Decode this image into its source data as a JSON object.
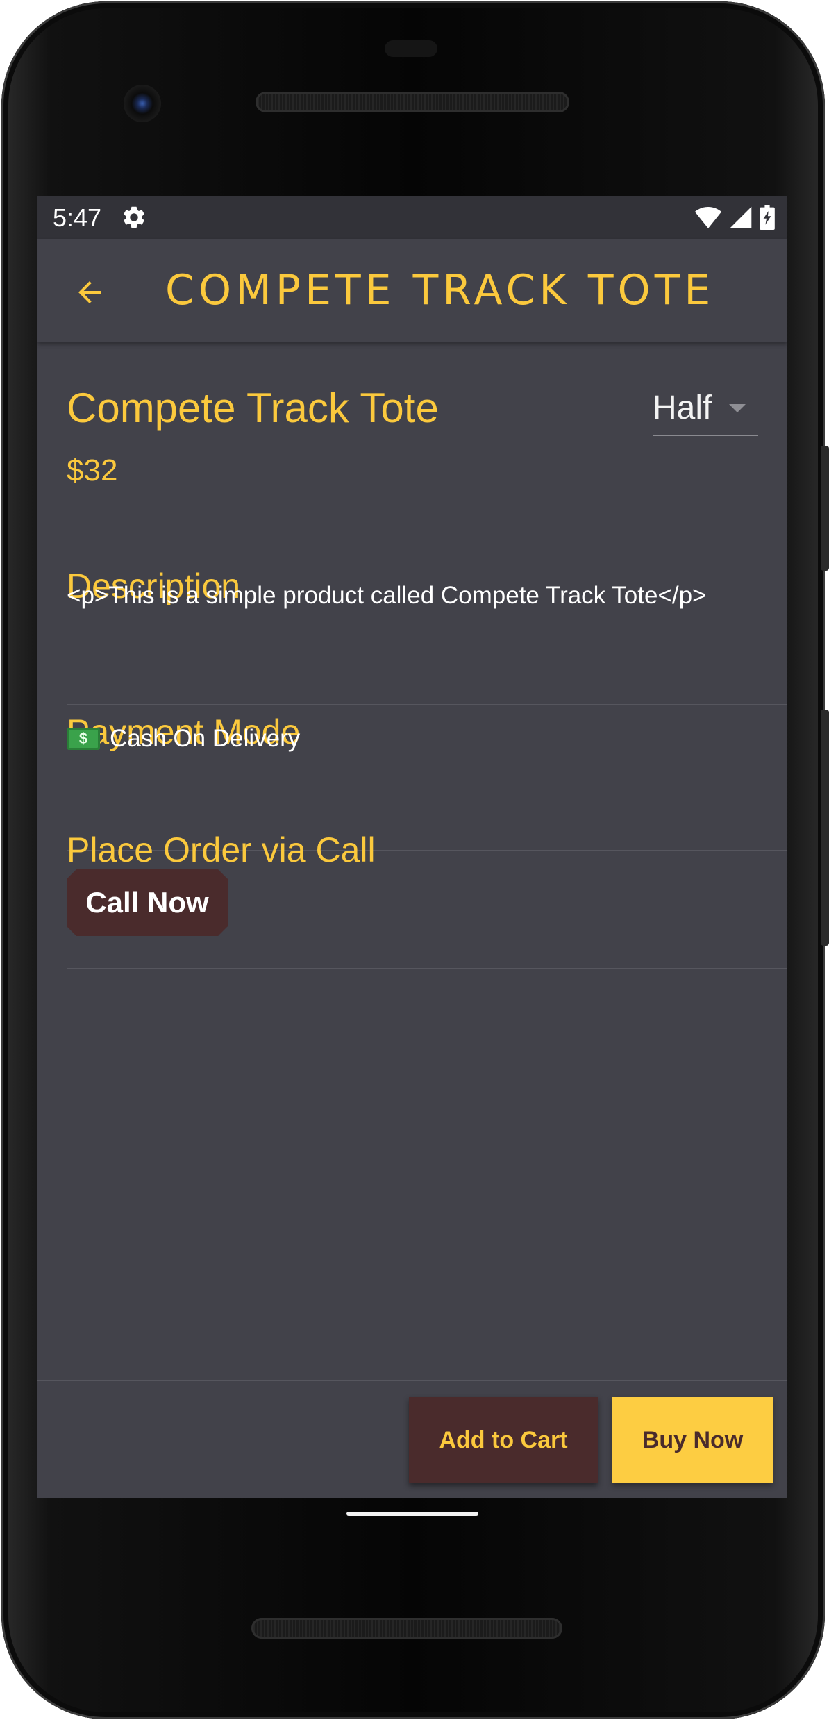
{
  "status_bar": {
    "time": "5:47",
    "icons": [
      "settings-gear-icon",
      "wifi-icon",
      "cell-signal-icon",
      "battery-charging-icon"
    ]
  },
  "app_bar": {
    "title": "COMPETE TRACK TOTE",
    "back_icon": "arrow-back-icon"
  },
  "product": {
    "name": "Compete Track Tote",
    "price": "$32",
    "variant": {
      "selected": "Half"
    }
  },
  "description": {
    "heading": "Description",
    "text": "<p>This is a simple product called Compete Track Tote</p>"
  },
  "payment": {
    "heading": "Payment Mode",
    "icon": "cash-money-icon",
    "mode": "Cash On Delivery"
  },
  "call_order": {
    "heading": "Place Order via Call",
    "button_label": "Call Now"
  },
  "actions": {
    "add_to_cart_label": "Add to Cart",
    "buy_now_label": "Buy Now"
  },
  "colors": {
    "accent": "#fbc93d",
    "background": "#42424a",
    "status_bar": "#323238",
    "secondary_button": "#4a2b2c",
    "primary_button": "#fdcd42"
  }
}
